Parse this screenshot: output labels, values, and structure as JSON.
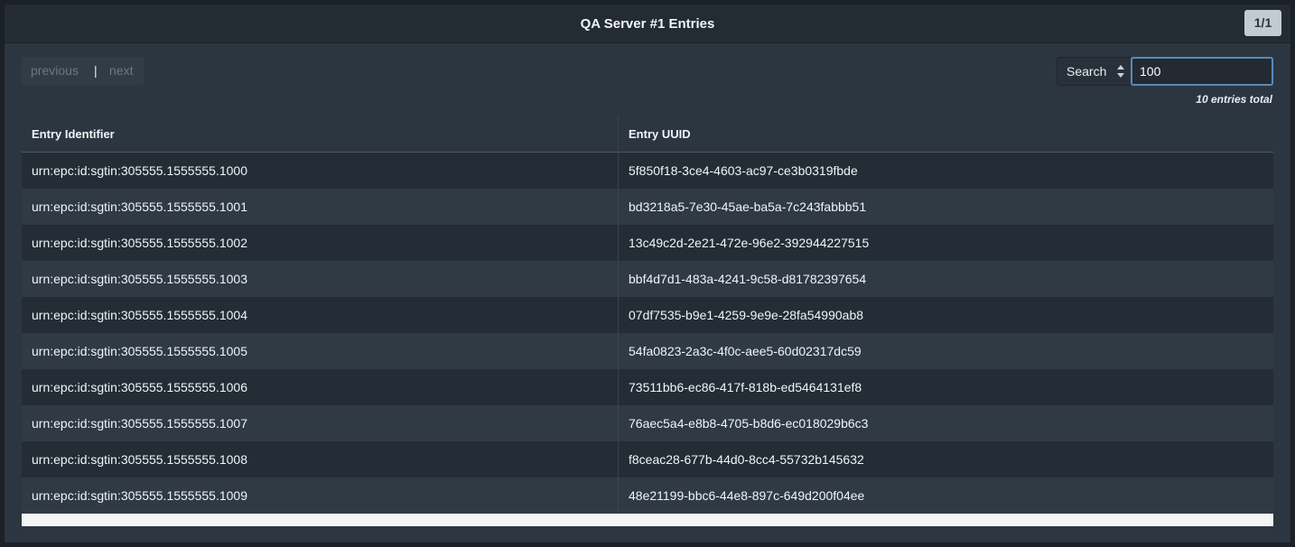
{
  "header": {
    "title": "QA Server #1 Entries",
    "page_indicator": "1/1"
  },
  "pager": {
    "previous_label": "previous",
    "separator": "|",
    "next_label": "next"
  },
  "search": {
    "mode_label": "Search",
    "value": "100"
  },
  "summary": {
    "total_text": "10 entries total"
  },
  "table": {
    "columns": [
      "Entry Identifier",
      "Entry UUID"
    ],
    "rows": [
      [
        "urn:epc:id:sgtin:305555.1555555.1000",
        "5f850f18-3ce4-4603-ac97-ce3b0319fbde"
      ],
      [
        "urn:epc:id:sgtin:305555.1555555.1001",
        "bd3218a5-7e30-45ae-ba5a-7c243fabbb51"
      ],
      [
        "urn:epc:id:sgtin:305555.1555555.1002",
        "13c49c2d-2e21-472e-96e2-392944227515"
      ],
      [
        "urn:epc:id:sgtin:305555.1555555.1003",
        "bbf4d7d1-483a-4241-9c58-d81782397654"
      ],
      [
        "urn:epc:id:sgtin:305555.1555555.1004",
        "07df7535-b9e1-4259-9e9e-28fa54990ab8"
      ],
      [
        "urn:epc:id:sgtin:305555.1555555.1005",
        "54fa0823-2a3c-4f0c-aee5-60d02317dc59"
      ],
      [
        "urn:epc:id:sgtin:305555.1555555.1006",
        "73511bb6-ec86-417f-818b-ed5464131ef8"
      ],
      [
        "urn:epc:id:sgtin:305555.1555555.1007",
        "76aec5a4-e8b8-4705-b8d6-ec018029b6c3"
      ],
      [
        "urn:epc:id:sgtin:305555.1555555.1008",
        "f8ceac28-677b-44d0-8cc4-55732b145632"
      ],
      [
        "urn:epc:id:sgtin:305555.1555555.1009",
        "48e21199-bbc6-44e8-897c-649d200f04ee"
      ]
    ]
  }
}
